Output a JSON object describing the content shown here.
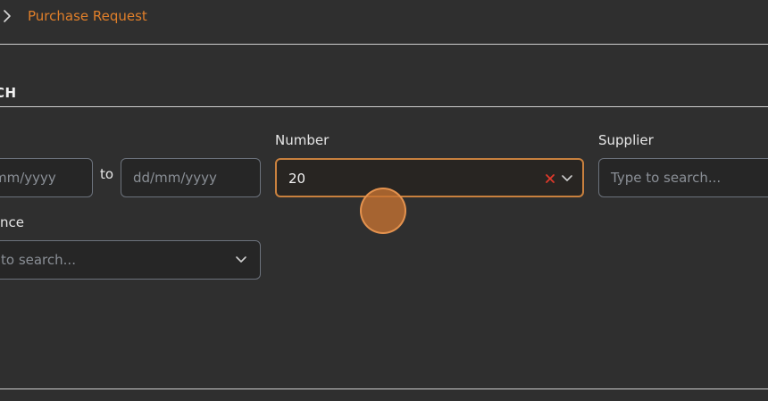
{
  "breadcrumb": {
    "current": "Purchase Request"
  },
  "section": {
    "title": "CH"
  },
  "filters": {
    "date_to_label": "to",
    "date_from_placeholder": "mm/yyyy",
    "date_to_placeholder": "dd/mm/yyyy",
    "number": {
      "label": "Number",
      "value": "20"
    },
    "supplier": {
      "label": "Supplier",
      "placeholder": "Type to search..."
    },
    "reference": {
      "label": "nce",
      "placeholder": "to search..."
    }
  },
  "colors": {
    "accent": "#e07f2a",
    "background": "#2f2f2f",
    "focus_border": "#c8803e",
    "clear_icon": "#e0392b"
  }
}
